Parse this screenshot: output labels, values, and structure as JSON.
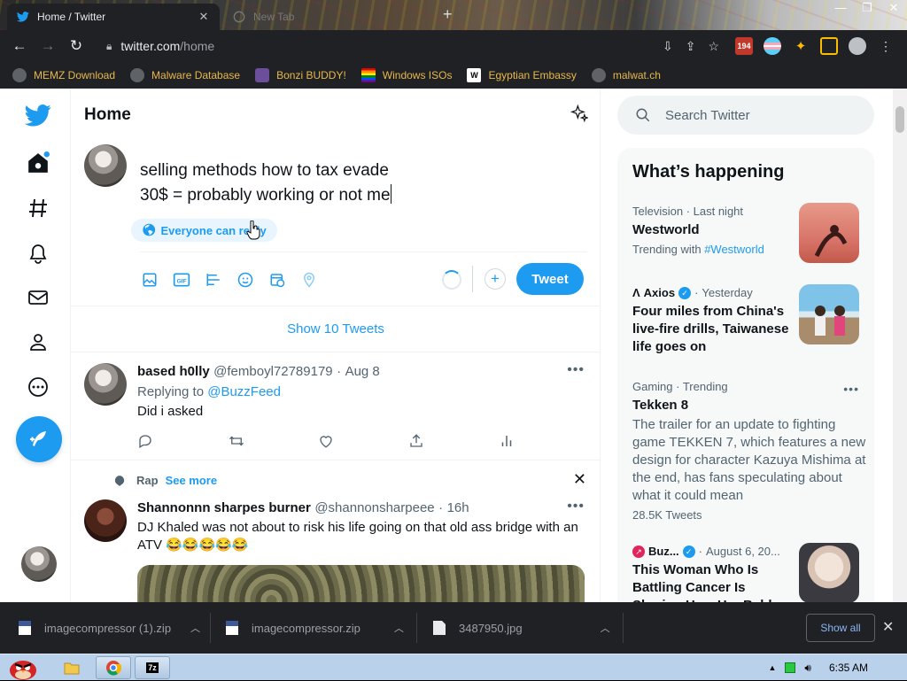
{
  "browser": {
    "active_tab": {
      "title": "Home / Twitter"
    },
    "inactive_tab": {
      "title": "New Tab"
    },
    "url": {
      "host": "twitter.com",
      "path": "/home"
    },
    "extension_badge": "194",
    "bookmarks": [
      {
        "label": "MEMZ Download",
        "icon": "globe-icon"
      },
      {
        "label": "Malware Database",
        "icon": "globe-icon"
      },
      {
        "label": "Bonzi BUDDY!",
        "icon": "bonzi-icon"
      },
      {
        "label": "Windows ISOs",
        "icon": "windows-flag-icon"
      },
      {
        "label": "Egyptian Embassy",
        "icon": "wix-icon"
      },
      {
        "label": "malwat.ch",
        "icon": "globe-icon"
      }
    ]
  },
  "twitter": {
    "header": {
      "title": "Home"
    },
    "compose": {
      "line1": "selling methods how to tax evade",
      "line2": "30$ = probably working or not me",
      "reply_setting": "Everyone can reply",
      "tweet_button": "Tweet"
    },
    "show_tweets": "Show 10 Tweets",
    "tweets": [
      {
        "name": "based h0lly",
        "handle": "@femboyl72789179",
        "time": "Aug 8",
        "replying_prefix": "Replying to",
        "replying_to": "@BuzzFeed",
        "text": "Did i asked"
      },
      {
        "topic": "Rap",
        "see_more": "See more",
        "name": "Shannonnn sharpes burner",
        "handle": "@shannonsharpeee",
        "time": "16h",
        "text": "DJ Khaled was not about to risk his life going on that old ass bridge with an ATV 😂😂😂😂😂"
      }
    ],
    "search": {
      "placeholder": "Search Twitter"
    },
    "trends": {
      "title": "What’s happening",
      "items": [
        {
          "category": "Television · Last night",
          "headline": "Westworld",
          "sub_prefix": "Trending with",
          "sub_link": "#Westworld"
        },
        {
          "source": "Axios",
          "time": "Yesterday",
          "headline": "Four miles from China's live-fire drills, Taiwanese life goes on"
        },
        {
          "category": "Gaming · Trending",
          "headline": "Tekken 8",
          "description": "The trailer for an update to fighting game TEKKEN 7, which features a new design for character Kazuya Mishima at the end, has fans speculating about what it could mean",
          "count": "28.5K Tweets"
        },
        {
          "source": "Buz...",
          "time": "August 6, 20...",
          "headline": "This Woman Who Is Battling Cancer Is Sharing How Her Bald..."
        }
      ]
    }
  },
  "downloads": {
    "items": [
      {
        "name": "imagecompressor (1).zip"
      },
      {
        "name": "imagecompressor.zip"
      },
      {
        "name": "3487950.jpg"
      }
    ],
    "show_all": "Show all"
  },
  "taskbar": {
    "time": "6:35 AM"
  }
}
